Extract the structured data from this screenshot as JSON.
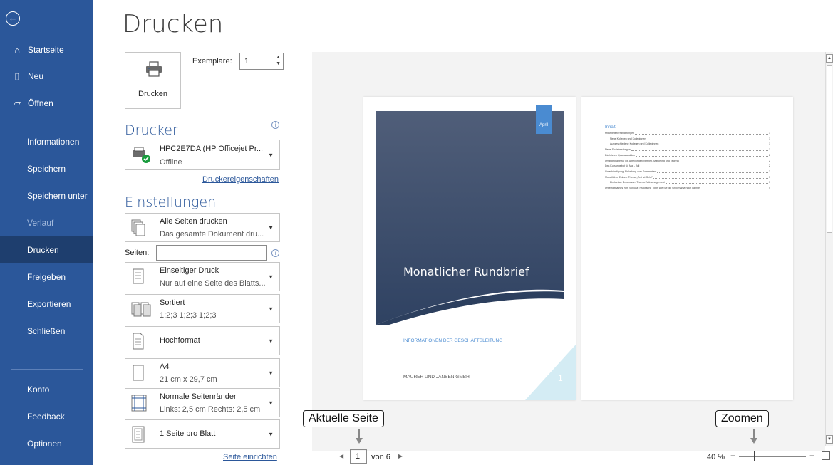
{
  "sidebar": {
    "items": [
      {
        "label": "Startseite",
        "icon": "home-icon"
      },
      {
        "label": "Neu",
        "icon": "new-document-icon"
      },
      {
        "label": "Öffnen",
        "icon": "open-folder-icon"
      },
      {
        "label": "Informationen"
      },
      {
        "label": "Speichern"
      },
      {
        "label": "Speichern unter"
      },
      {
        "label": "Verlauf"
      },
      {
        "label": "Drucken"
      },
      {
        "label": "Freigeben"
      },
      {
        "label": "Exportieren"
      },
      {
        "label": "Schließen"
      },
      {
        "label": "Konto"
      },
      {
        "label": "Feedback"
      },
      {
        "label": "Optionen"
      }
    ]
  },
  "page": {
    "title": "Drucken"
  },
  "print": {
    "button_label": "Drucken",
    "copies_label": "Exemplare:",
    "copies_value": "1"
  },
  "printer": {
    "heading": "Drucker",
    "name": "HPC2E7DA (HP Officejet Pr...",
    "status": "Offline",
    "properties_link": "Druckereigenschaften"
  },
  "settings": {
    "heading": "Einstellungen",
    "pages_label": "Seiten:",
    "pages_value": "",
    "dropdowns": [
      {
        "title": "Alle Seiten drucken",
        "subtitle": "Das gesamte Dokument dru..."
      },
      {
        "title": "Einseitiger Druck",
        "subtitle": "Nur auf eine Seite des Blatts..."
      },
      {
        "title": "Sortiert",
        "subtitle": "1;2;3    1;2;3    1;2;3"
      },
      {
        "title": "Hochformat",
        "subtitle": ""
      },
      {
        "title": "A4",
        "subtitle": "21 cm x 29,7 cm"
      },
      {
        "title": "Normale Seitenränder",
        "subtitle": "Links: 2,5 cm   Rechts: 2,5 cm"
      },
      {
        "title": "1 Seite pro Blatt",
        "subtitle": ""
      }
    ],
    "page_setup_link": "Seite einrichten"
  },
  "preview": {
    "page1": {
      "month_tag": "April",
      "title": "Monatlicher Rundbrief",
      "subtitle": "INFORMATIONEN DER GESCHÄFTSLEITUNG",
      "company": "MAURER UND JANSEN GMBH",
      "page_number": "1"
    },
    "page2": {
      "toc_heading": "Inhalt",
      "toc": [
        {
          "text": "Mitarbeiterveränderungen",
          "page": "1",
          "indent": false
        },
        {
          "text": "Neue Kollegen und Kolleginnen",
          "page": "1",
          "indent": true
        },
        {
          "text": "Ausgeschiedene Kollegen und Kolleginnen",
          "page": "1",
          "indent": true
        },
        {
          "text": "Neue Sozialleistungen",
          "page": "1",
          "indent": false
        },
        {
          "text": "Die letzten Quartalszahlen",
          "page": "2",
          "indent": false
        },
        {
          "text": "Umzugspläne für die Abteilungen Vertrieb, Marketing und Technik",
          "page": "2",
          "indent": false
        },
        {
          "text": "Das Kursangebot für Mai - Juli",
          "page": "2",
          "indent": false
        },
        {
          "text": "Vorankündigung: Einladung zum Sommerfest",
          "page": "3",
          "indent": false
        },
        {
          "text": "Monatlicher Exkurs: Thema „Zeit ist Geld!“",
          "page": "3",
          "indent": false
        },
        {
          "text": "Ein kleiner Exkurs zum Thema Zeitmanagement",
          "page": "3",
          "indent": true
        },
        {
          "text": "Unterhaltsames zum Schluss: Praktische Tipps wie Sie die Großmama noch kannte",
          "page": "4",
          "indent": false
        }
      ]
    }
  },
  "navigation": {
    "current_page": "1",
    "of_label": "von 6"
  },
  "zoom": {
    "percent": "40 %"
  },
  "callouts": {
    "current_page": "Aktuelle Seite",
    "zoom": "Zoomen"
  },
  "colors": {
    "sidebar": "#2b579a",
    "sidebar_active": "#1e3e6e",
    "accent": "#2b579a",
    "hero": "#3f5474"
  }
}
